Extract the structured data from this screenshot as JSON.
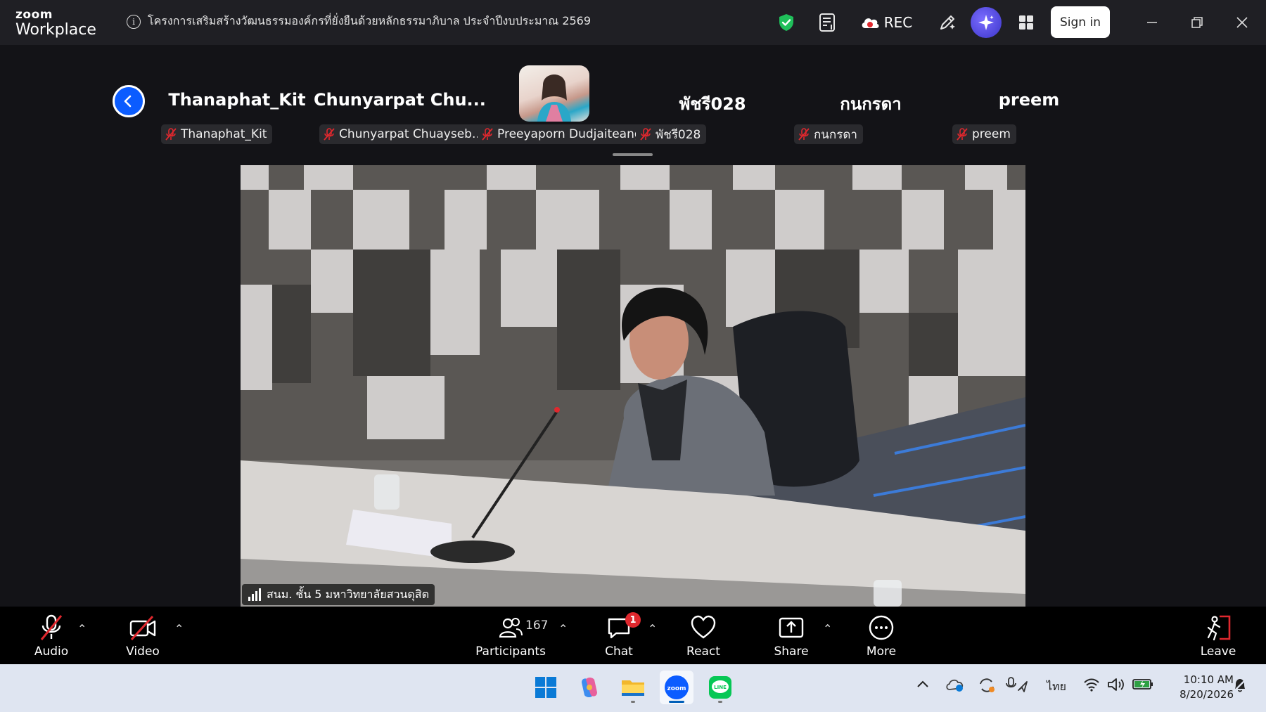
{
  "brand": {
    "line1": "zoom",
    "line2": "Workplace"
  },
  "meeting": {
    "title": "โครงการเสริมสร้างวัฒนธรรมองค์กรที่ยั่งยืนด้วยหลักธรรมาภิบาล ประจำปีงบประมาณ 2569"
  },
  "titlebar": {
    "rec_label": "REC",
    "signin_label": "Sign in"
  },
  "colors": {
    "accent": "#0b5cff",
    "shield": "#1fbf5a",
    "muted_red": "#e0282e",
    "ai_purple": "#5b4ef0"
  },
  "gallery": {
    "tiles": [
      {
        "name": "Thanaphat_Kit",
        "chip": "Thanaphat_Kit",
        "muted": true
      },
      {
        "name": "Chunyarpat  Chu...",
        "chip": "Chunyarpat Chuayseb...",
        "muted": true
      },
      {
        "name": "",
        "chip": "Preeyaporn Dudjaiteang",
        "muted": true,
        "has_photo": true
      },
      {
        "name": "พัชรี028",
        "chip": "พัชรี028",
        "muted": true
      },
      {
        "name": "กนกรดา",
        "chip": "กนกรดา",
        "muted": true
      },
      {
        "name": "preem",
        "chip": "preem",
        "muted": true
      }
    ]
  },
  "video": {
    "label": "สนม. ชั้น 5 มหาวิทยาลัยสวนดุสิต"
  },
  "toolbar": {
    "audio": "Audio",
    "video": "Video",
    "participants": "Participants",
    "participants_count": "167",
    "chat": "Chat",
    "chat_badge": "1",
    "react": "React",
    "share": "Share",
    "more": "More",
    "leave": "Leave"
  },
  "taskbar": {
    "apps": [
      "windows-start",
      "copilot",
      "file-explorer",
      "zoom",
      "line"
    ],
    "active_app": "zoom",
    "language": "ไทย",
    "time": "10:10 AM",
    "date": "8/20/2026"
  }
}
